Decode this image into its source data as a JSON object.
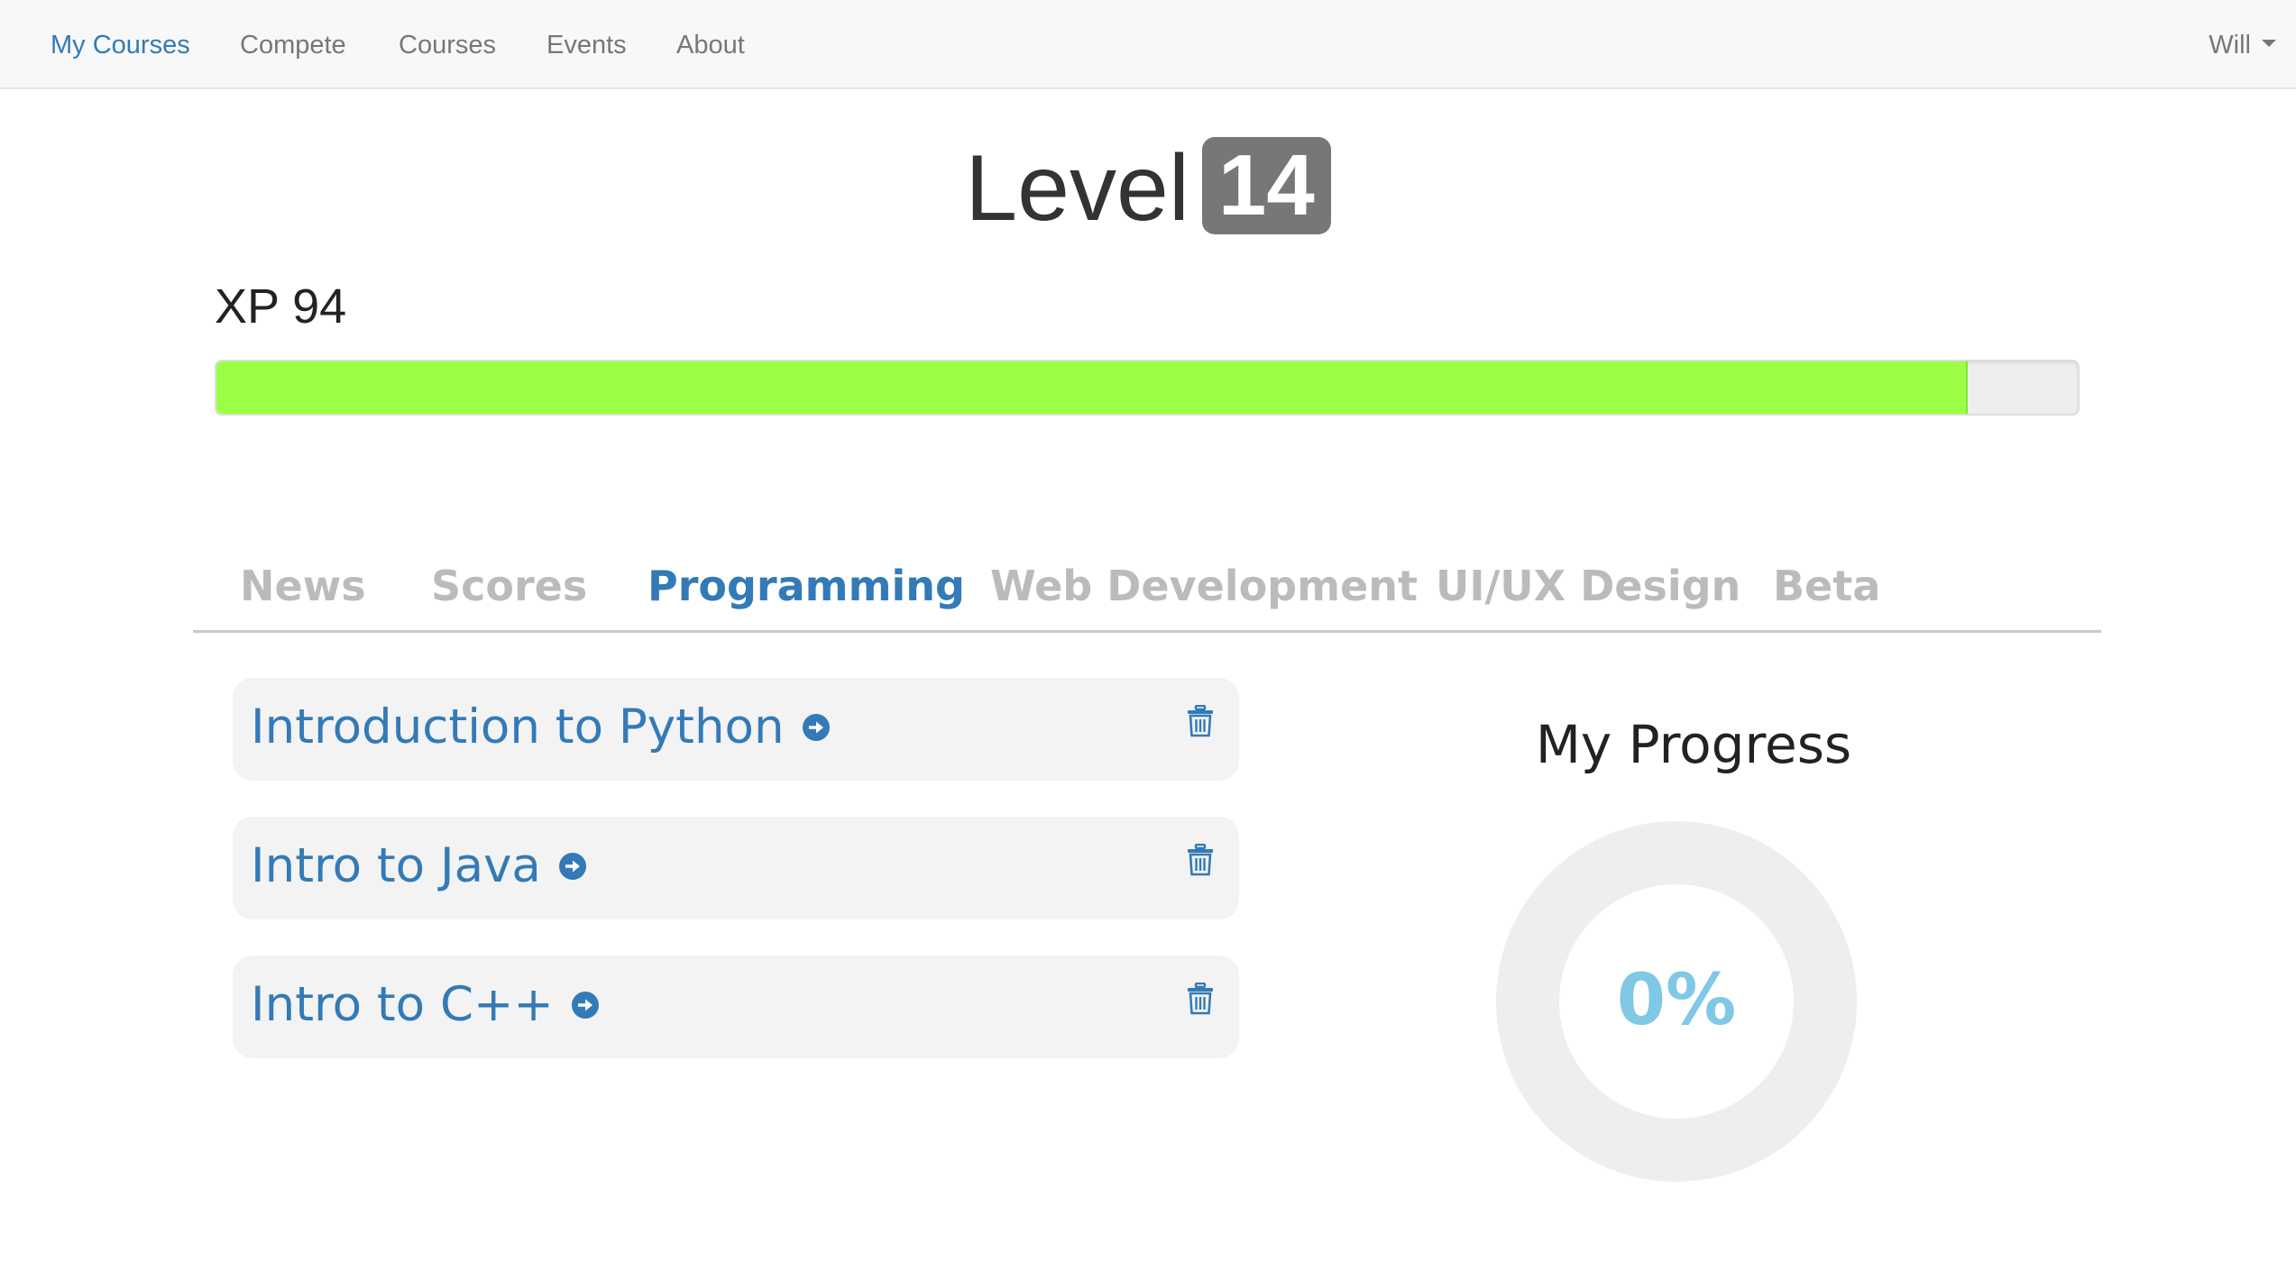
{
  "navbar": {
    "items": [
      {
        "label": "My Courses",
        "active": true
      },
      {
        "label": "Compete",
        "active": false
      },
      {
        "label": "Courses",
        "active": false
      },
      {
        "label": "Events",
        "active": false
      },
      {
        "label": "About",
        "active": false
      }
    ],
    "user": "Will"
  },
  "level": {
    "label": "Level",
    "value": "14"
  },
  "xp": {
    "label": "XP 94",
    "progress_percent": 94
  },
  "tabs": [
    {
      "label": "News",
      "active": false
    },
    {
      "label": "Scores",
      "active": false
    },
    {
      "label": "Programming",
      "active": true
    },
    {
      "label": "Web Development",
      "active": false
    },
    {
      "label": "UI/UX Design",
      "active": false
    },
    {
      "label": "Beta",
      "active": false
    }
  ],
  "courses": [
    {
      "title": "Introduction to Python"
    },
    {
      "title": "Intro to Java"
    },
    {
      "title": "Intro to C++"
    }
  ],
  "my_progress": {
    "title": "My Progress",
    "value_text": "0%",
    "percent": 0
  },
  "colors": {
    "accent": "#337ab7",
    "progress_fill": "#9cff45",
    "donut_track": "#eeeeee",
    "donut_text": "#7fc8e6",
    "badge": "#777777"
  },
  "icons": {
    "course_arrow": "arrow-right-circle-icon",
    "course_delete": "trash-icon",
    "user_menu": "caret-down-icon"
  }
}
